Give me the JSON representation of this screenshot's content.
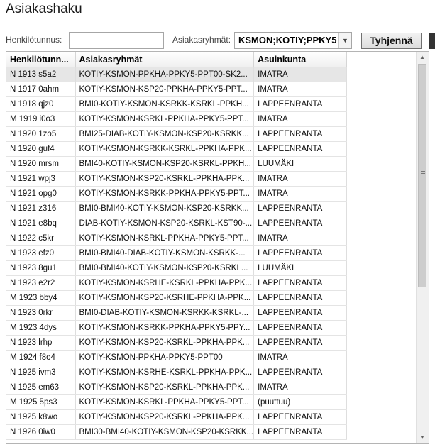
{
  "page": {
    "title": "Asiakashaku"
  },
  "filters": {
    "henkilotunnus_label": "Henkilötunnus:",
    "henkilotunnus_value": "",
    "asiakasryhmat_label": "Asiakasryhmät:",
    "asiakasryhmat_value": "KSMON;KOTIY;PPKY5",
    "clear_button": "Tyhjennä"
  },
  "grid": {
    "columns": [
      "Henkilötunn...",
      "Asiakasryhmät",
      "Asuinkunta"
    ],
    "selected_row": 0,
    "rows": [
      [
        "N 1913 s5a2",
        "KOTIY-KSMON-PPKHA-PPKY5-PPT00-SK2...",
        "IMATRA"
      ],
      [
        "N 1917 0ahm",
        "KOTIY-KSMON-KSP20-PPKHA-PPKY5-PPT...",
        "IMATRA"
      ],
      [
        "N 1918 qjz0",
        "BMI0-KOTIY-KSMON-KSRKK-KSRKL-PPKH...",
        "LAPPEENRANTA"
      ],
      [
        "M 1919 i0o3",
        "KOTIY-KSMON-KSRKL-PPKHA-PPKY5-PPT...",
        "IMATRA"
      ],
      [
        "N 1920 1zo5",
        "BMI25-DIAB-KOTIY-KSMON-KSP20-KSRKK...",
        "LAPPEENRANTA"
      ],
      [
        "N 1920 guf4",
        "KOTIY-KSMON-KSRKK-KSRKL-PPKHA-PPK...",
        "LAPPEENRANTA"
      ],
      [
        "N 1920 mrsm",
        "BMI40-KOTIY-KSMON-KSP20-KSRKL-PPKH...",
        "LUUMÄKI"
      ],
      [
        "N 1921 wpj3",
        "KOTIY-KSMON-KSP20-KSRKL-PPKHA-PPK...",
        "IMATRA"
      ],
      [
        "N 1921 opg0",
        "KOTIY-KSMON-KSRKK-PPKHA-PPKY5-PPT...",
        "IMATRA"
      ],
      [
        "N 1921 z316",
        "BMI0-BMI40-KOTIY-KSMON-KSP20-KSRKK...",
        "LAPPEENRANTA"
      ],
      [
        "N 1921 e8bq",
        "DIAB-KOTIY-KSMON-KSP20-KSRKL-KST90-...",
        "LAPPEENRANTA"
      ],
      [
        "N 1922 c5kr",
        "KOTIY-KSMON-KSRKL-PPKHA-PPKY5-PPT...",
        "IMATRA"
      ],
      [
        "N 1923 efz0",
        "BMI0-BMI40-DIAB-KOTIY-KSMON-KSRKK-...",
        "LAPPEENRANTA"
      ],
      [
        "N 1923 8gu1",
        "BMI0-BMI40-KOTIY-KSMON-KSP20-KSRKL...",
        "LUUMÄKI"
      ],
      [
        "N 1923 e2r2",
        "KOTIY-KSMON-KSRHE-KSRKL-PPKHA-PPK...",
        "LAPPEENRANTA"
      ],
      [
        "M 1923 bby4",
        "KOTIY-KSMON-KSP20-KSRHE-PPKHA-PPK...",
        "LAPPEENRANTA"
      ],
      [
        "N 1923 0rkr",
        "BMI0-DIAB-KOTIY-KSMON-KSRKK-KSRKL-...",
        "LAPPEENRANTA"
      ],
      [
        "M 1923 4dys",
        "KOTIY-KSMON-KSRKK-PPKHA-PPKY5-PPY...",
        "LAPPEENRANTA"
      ],
      [
        "N 1923 lrhp",
        "KOTIY-KSMON-KSP20-KSRKL-PPKHA-PPK...",
        "LAPPEENRANTA"
      ],
      [
        "M 1924 f8o4",
        "KOTIY-KSMON-PPKHA-PPKY5-PPT00",
        "IMATRA"
      ],
      [
        "N 1925 ivm3",
        "KOTIY-KSMON-KSRHE-KSRKL-PPKHA-PPK...",
        "LAPPEENRANTA"
      ],
      [
        "N 1925 em63",
        "KOTIY-KSMON-KSP20-KSRKL-PPKHA-PPK...",
        "IMATRA"
      ],
      [
        "M 1925 5ps3",
        "KOTIY-KSMON-KSRKL-PPKHA-PPKY5-PPT...",
        "(puuttuu)"
      ],
      [
        "N 1925 k8wo",
        "KOTIY-KSMON-KSP20-KSRKL-PPKHA-PPK...",
        "LAPPEENRANTA"
      ],
      [
        "N 1926 0iw0",
        "BMI30-BMI40-KOTIY-KSMON-KSP20-KSRKK...",
        "LAPPEENRANTA"
      ]
    ]
  },
  "scrollbar": {
    "up_icon": "arrow-up-icon",
    "down_icon": "arrow-down-icon",
    "grip_icon": "grip-icon"
  }
}
